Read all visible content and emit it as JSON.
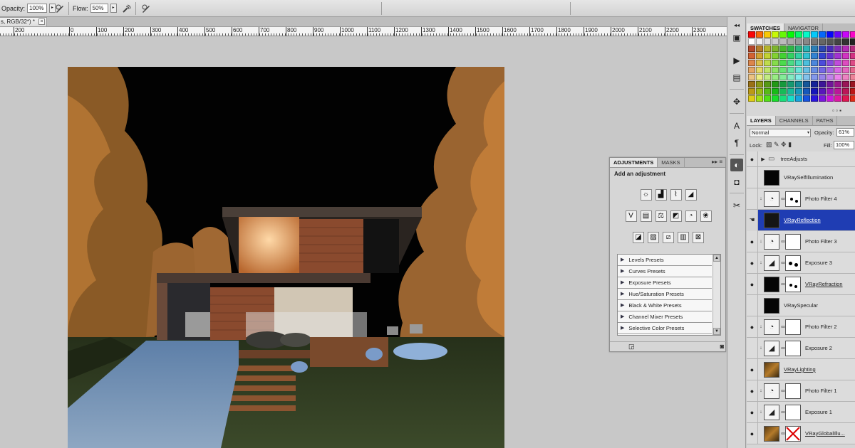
{
  "options_bar": {
    "opacity_label": "Opacity:",
    "opacity_value": "100%",
    "flow_label": "Flow:",
    "flow_value": "50%"
  },
  "document_tab": {
    "title": "s, RGB/32*) *",
    "close": "×"
  },
  "ruler": {
    "ticks": [
      "200",
      "0",
      "100",
      "200",
      "300",
      "400",
      "500",
      "600",
      "700",
      "800",
      "900",
      "1000",
      "1100",
      "1200",
      "1300",
      "1400",
      "1500",
      "1600",
      "1700",
      "1800",
      "1900",
      "2000",
      "2100",
      "2200",
      "2300"
    ]
  },
  "swatches_panel": {
    "tabs": [
      "SWATCHES",
      "NAVIGATOR"
    ]
  },
  "layers_panel": {
    "tabs": [
      "LAYERS",
      "CHANNELS",
      "PATHS"
    ],
    "blend_mode": "Normal",
    "opacity_label": "Opacity:",
    "opacity_value": "61%",
    "lock_label": "Lock:",
    "fill_label": "Fill:",
    "fill_value": "100%",
    "layers": [
      {
        "name": "treeAdjusts",
        "kind": "group"
      },
      {
        "name": "VRaySelfIllumination",
        "kind": "image"
      },
      {
        "name": "Photo Filter 4",
        "kind": "adjustment"
      },
      {
        "name": "VRayReflection",
        "kind": "image",
        "selected": true
      },
      {
        "name": "Photo Filter 3",
        "kind": "adjustment"
      },
      {
        "name": "Exposure 3",
        "kind": "adjustment"
      },
      {
        "name": "VRayRefraction",
        "kind": "image"
      },
      {
        "name": "VRaySpecular",
        "kind": "image"
      },
      {
        "name": "Photo Filter 2",
        "kind": "adjustment"
      },
      {
        "name": "Exposure 2",
        "kind": "adjustment"
      },
      {
        "name": "VRayLighting",
        "kind": "image"
      },
      {
        "name": "Photo Filter 1",
        "kind": "adjustment"
      },
      {
        "name": "Exposure 1",
        "kind": "adjustment"
      },
      {
        "name": "VRayGlobalIllu...",
        "kind": "image"
      }
    ]
  },
  "adjustments_panel": {
    "tabs": [
      "ADJUSTMENTS",
      "MASKS"
    ],
    "title": "Add an adjustment",
    "presets": [
      "Levels Presets",
      "Curves Presets",
      "Exposure Presets",
      "Hue/Saturation Presets",
      "Black & White Presets",
      "Channel Mixer Presets",
      "Selective Color Presets"
    ]
  },
  "colors": {
    "selection_blue": "#1f3db3",
    "panel_gray": "#d6d6d6"
  }
}
